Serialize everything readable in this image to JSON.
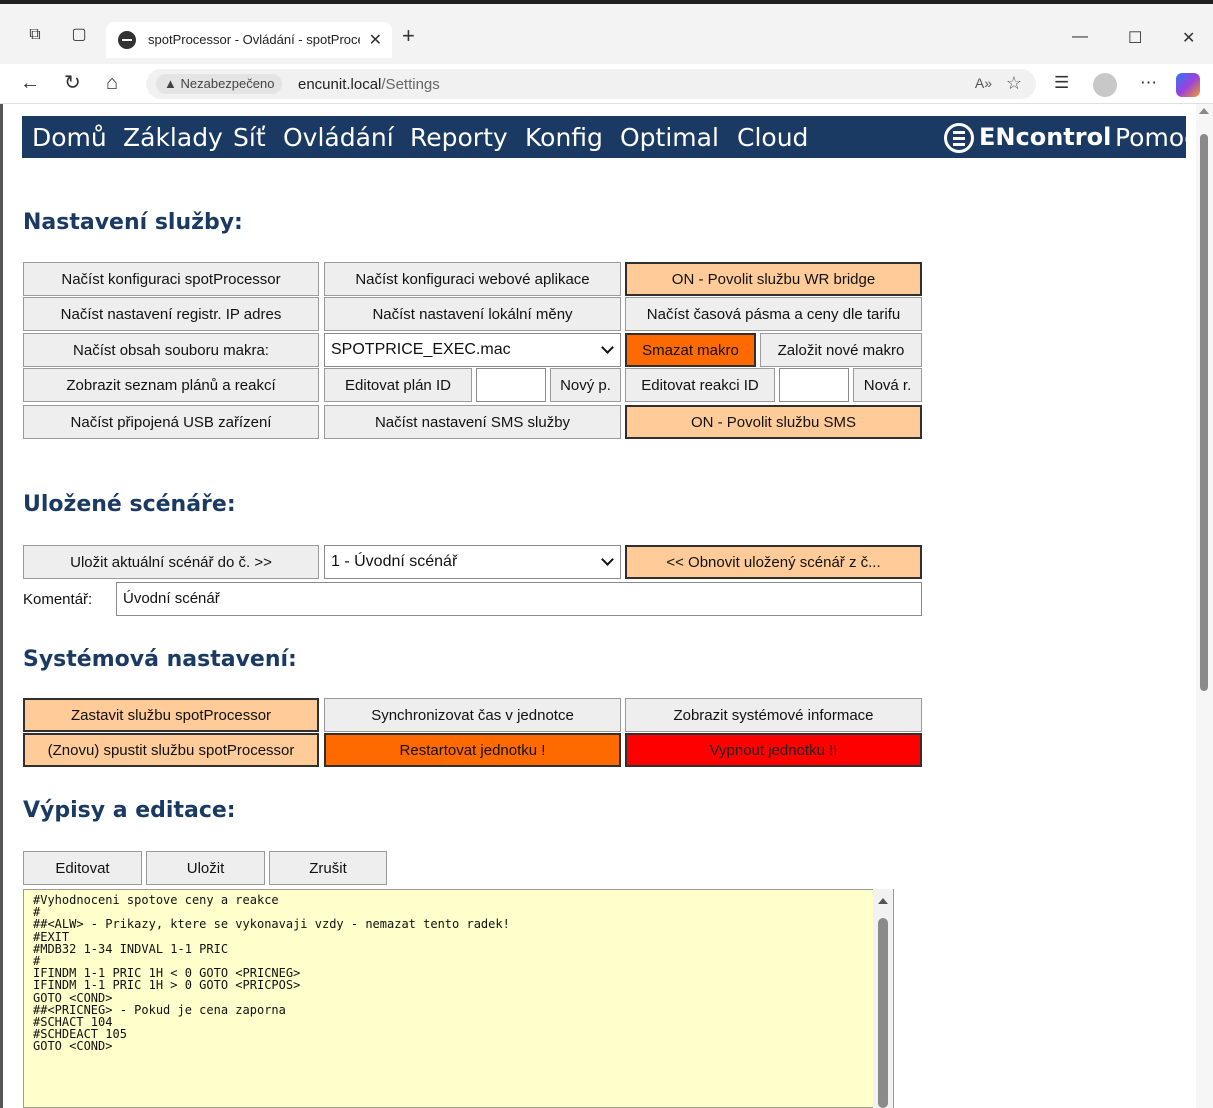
{
  "browser": {
    "tab_title": "spotProcessor - Ovládání - spotProcessor",
    "not_secure": "Nezabezpečeno",
    "url_host": "encunit.local",
    "url_path": "/Settings"
  },
  "nav": {
    "items": [
      "Domů",
      "Základy",
      "Síť",
      "Ovládání",
      "Reporty",
      "Konfig",
      "Optimal",
      "Cloud"
    ],
    "brand": "ENcontrol",
    "help": "Pomoc"
  },
  "service": {
    "heading": "Nastavení služby:",
    "load_spot_config": "Načíst konfiguraci spotProcessor",
    "load_web_config": "Načíst konfiguraci webové aplikace",
    "wr_bridge_toggle": "ON - Povolit službu WR bridge",
    "load_ip_registry": "Načíst nastavení registr. IP adres",
    "load_currency": "Načíst nastavení lokální měny",
    "load_tariff_zones": "Načíst časová pásma a ceny dle tarifu",
    "load_macro": "Načíst obsah souboru makra:",
    "macro_selected": "SPOTPRICE_EXEC.mac",
    "delete_macro": "Smazat makro",
    "new_macro": "Založit nové makro",
    "show_plans": "Zobrazit seznam plánů a reakcí",
    "edit_plan_id": "Editovat plán ID",
    "new_plan": "Nový p.",
    "edit_reaction_id": "Editovat reakci ID",
    "new_reaction": "Nová r.",
    "load_usb": "Načíst připojená USB zařízení",
    "load_sms": "Načíst nastavení SMS služby",
    "sms_toggle": "ON - Povolit službu SMS"
  },
  "scenarios": {
    "heading": "Uložené scénáře:",
    "save_current": "Uložit aktuální scénář do č. >>",
    "selected": "1 - Úvodní scénář",
    "restore": "<< Obnovit uložený scénář z č...",
    "comment_label": "Komentář:",
    "comment_value": "Úvodní scénář"
  },
  "system": {
    "heading": "Systémová nastavení:",
    "stop_service": "Zastavit službu spotProcessor",
    "sync_time": "Synchronizovat čas v jednotce",
    "show_sysinfo": "Zobrazit systémové informace",
    "restart_service": "(Znovu) spustit službu spotProcessor",
    "restart_unit": "Restartovat jednotku !",
    "shutdown_unit": "Vypnout jednotku !!"
  },
  "editor": {
    "heading": "Výpisy a editace:",
    "edit": "Editovat",
    "save": "Uložit",
    "cancel": "Zrušit",
    "content": "#Vyhodnoceni spotove ceny a reakce\n#\n##<ALW> - Prikazy, ktere se vykonavaji vzdy - nemazat tento radek!\n#EXIT\n#MDB32 1-34 INDVAL 1-1 PRIC\n#\nIFINDM 1-1 PRIC 1H < 0 GOTO <PRICNEG>\nIFINDM 1-1 PRIC 1H > 0 GOTO <PRICPOS>\nGOTO <COND>\n##<PRICNEG> - Pokud je cena zaporna\n#SCHACT 104\n#SCHDEACT 105\nGOTO <COND>"
  },
  "colors": {
    "nav_bg": "#1a3a64",
    "heading": "#1a3a64",
    "peach": "#ffcc99",
    "orange": "#ff6a00",
    "red": "#ff0000",
    "editor_bg": "#ffffcc"
  }
}
